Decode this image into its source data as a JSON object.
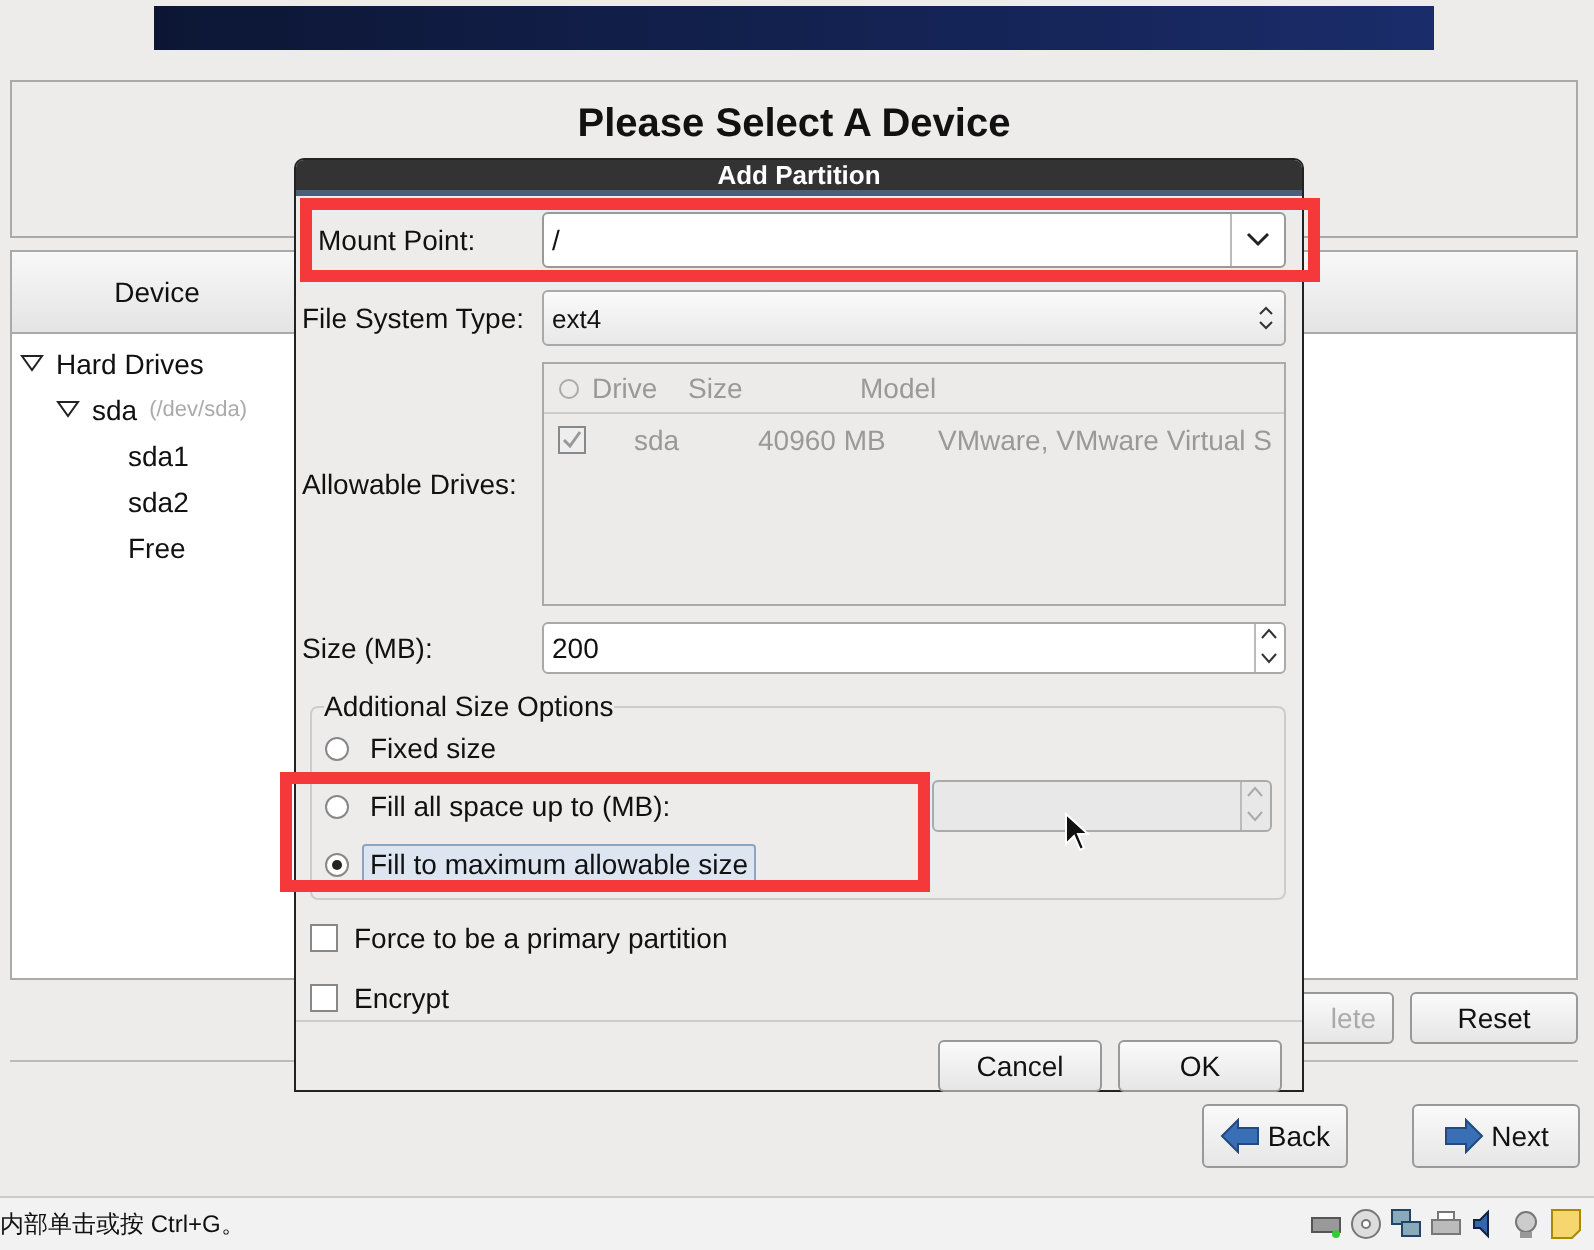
{
  "heading": "Please Select A Device",
  "device_table": {
    "column_1": "Device",
    "tree": [
      {
        "label": "Hard Drives",
        "expanded": true,
        "children": [
          {
            "label": "sda",
            "note": "(/dev/sda)",
            "expanded": true,
            "children": [
              {
                "label": "sda1"
              },
              {
                "label": "sda2"
              },
              {
                "label": "Free"
              }
            ]
          }
        ]
      }
    ]
  },
  "table_buttons": [
    {
      "label": "lete",
      "disabled": true
    },
    {
      "label": "Reset",
      "disabled": false
    }
  ],
  "nav_buttons": [
    {
      "label": "Back",
      "kind": "back"
    },
    {
      "label": "Next",
      "kind": "next"
    }
  ],
  "status_bar": {
    "text": "内部单击或按 Ctrl+G。"
  },
  "dialog": {
    "title": "Add Partition",
    "mount_point": {
      "label": "Mount Point:",
      "value": "/"
    },
    "file_system_type": {
      "label": "File System Type:",
      "value": "ext4"
    },
    "allowable_drives": {
      "label": "Allowable Drives:",
      "columns": [
        "Drive",
        "Size",
        "Model"
      ],
      "rows": [
        {
          "checked": true,
          "drive": "sda",
          "size": "40960 MB",
          "model": "VMware, VMware Virtual S"
        }
      ]
    },
    "size": {
      "label": "Size (MB):",
      "value": "200"
    },
    "size_options": {
      "title": "Additional Size Options",
      "options": [
        {
          "label": "Fixed size",
          "selected": false
        },
        {
          "label": "Fill all space up to (MB):",
          "selected": false
        },
        {
          "label": "Fill to maximum allowable size",
          "selected": true
        }
      ]
    },
    "checkboxes": [
      {
        "label": "Force to be a primary partition",
        "checked": false
      },
      {
        "label": "Encrypt",
        "checked": false
      }
    ],
    "buttons": [
      "Cancel",
      "OK"
    ]
  }
}
